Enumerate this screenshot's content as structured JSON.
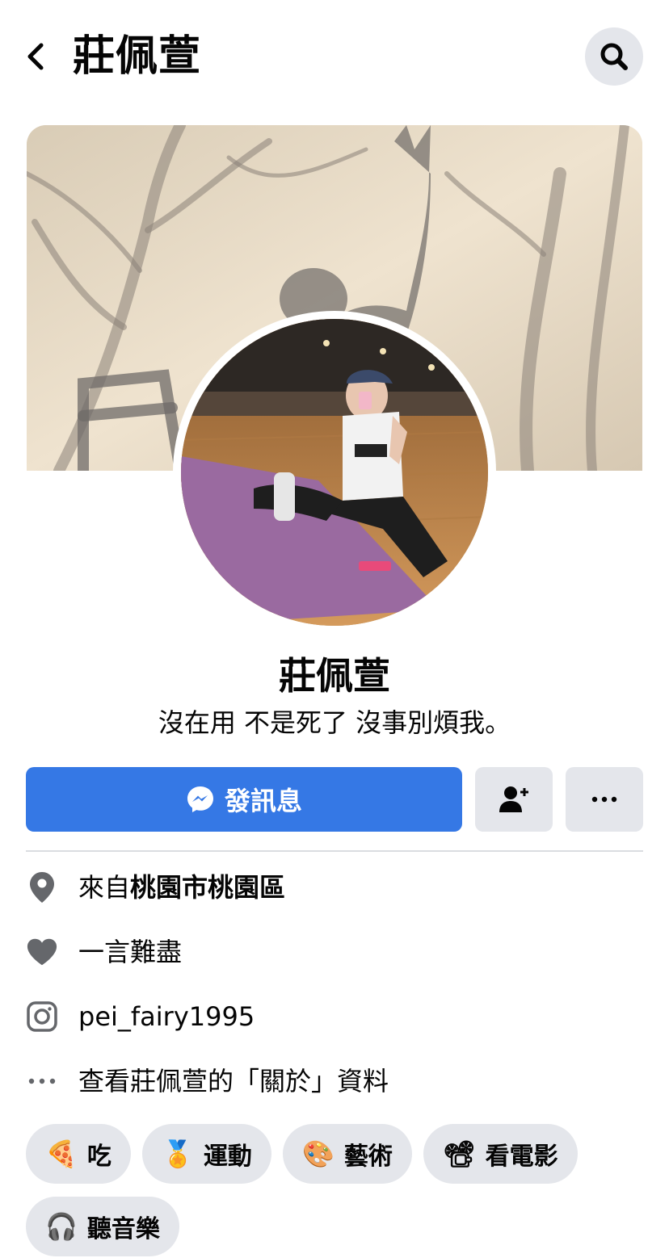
{
  "header": {
    "title": "莊佩萱"
  },
  "profile": {
    "name": "莊佩萱",
    "bio": "沒在用 不是死了 沒事別煩我。"
  },
  "actions": {
    "message_label": "發訊息"
  },
  "info": {
    "location_prefix": "來自",
    "location_place": "桃園市桃園區",
    "relationship": "一言難盡",
    "instagram": "pei_fairy1995",
    "about_link": "查看莊佩萱的「關於」資料"
  },
  "hobbies": [
    {
      "emoji": "🍕",
      "label": "吃"
    },
    {
      "emoji": "🏅",
      "label": "運動"
    },
    {
      "emoji": "🎨",
      "label": "藝術"
    },
    {
      "emoji": "📽",
      "label": "看電影"
    },
    {
      "emoji": "🎧",
      "label": "聽音樂"
    }
  ],
  "colors": {
    "primary_button": "#3578e5",
    "secondary_button": "#e4e6eb",
    "icon_gray": "#65676b"
  }
}
